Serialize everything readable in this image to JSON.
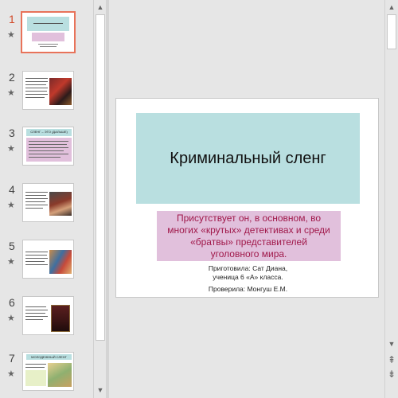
{
  "thumbnails": [
    {
      "number": "1",
      "star": "★",
      "active": true
    },
    {
      "number": "2",
      "star": "★",
      "active": false
    },
    {
      "number": "3",
      "star": "★",
      "active": false
    },
    {
      "number": "4",
      "star": "★",
      "active": false
    },
    {
      "number": "5",
      "star": "★",
      "active": false
    },
    {
      "number": "6",
      "star": "★",
      "active": false
    },
    {
      "number": "7",
      "star": "★",
      "active": false
    }
  ],
  "slide": {
    "title": "Криминальный сленг",
    "subtitle": "Присутствует он, в основном, во\nмногих «крутых» детективах и среди\n«братвы»  представителей\nуголовного мира.",
    "author": "Приготовила: Сат Диана,\nученица 6 «А» класса.",
    "checker": "Проверила: Монгуш Е.М."
  },
  "thumb3_title": "СЛЕНГ – ЭТО (ДАЛЬШЕ)",
  "thumb7_title": "МОЛОДЕЖНЫЙ СЛЕНГ",
  "colors": {
    "accent": "#d24726",
    "title_fill": "#b9dfe0",
    "subtitle_fill": "#e1c0dc",
    "subtitle_text": "#a0184a"
  },
  "icons": {
    "up": "▲",
    "down": "▼",
    "prev_slide": "⇞",
    "next_slide": "⇟"
  }
}
